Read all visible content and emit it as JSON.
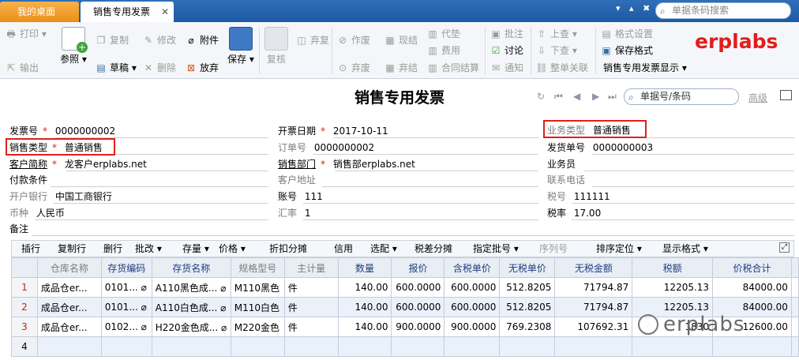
{
  "tabs": {
    "desk": "我的桌面",
    "sales": "销售专用发票",
    "close": "✕"
  },
  "global_search": {
    "placeholder": "单据条码搜索"
  },
  "logo": "erplabs",
  "toolbar": {
    "print": "打印",
    "export": "输出",
    "refer": "参照",
    "copy": "复制",
    "draft": "草稿",
    "modify": "修改",
    "delete": "删除",
    "attach": "附件",
    "discard": "放弃",
    "save": "保存",
    "review": "复核",
    "abandon": "弃复",
    "invalidate": "作废",
    "unvoid": "弃废",
    "cash": "现结",
    "uncash": "弃结",
    "advance": "代垫",
    "fee": "费用",
    "contract": "合同结算",
    "annotate": "批注",
    "discuss": "讨论",
    "notify": "通知",
    "prev": "上查",
    "next": "下查",
    "related": "整单关联",
    "format_settings": "格式设置",
    "save_format": "保存格式",
    "display_format": "销售专用发票显示"
  },
  "doc": {
    "title": "销售专用发票",
    "search_placeholder": "单据号/条码",
    "advanced": "高级"
  },
  "form": {
    "invoice_no": {
      "label": "发票号",
      "value": "0000000002"
    },
    "invoice_date": {
      "label": "开票日期",
      "value": "2017-10-11"
    },
    "biz_type": {
      "label": "业务类型",
      "value": "普通销售"
    },
    "sales_type": {
      "label": "销售类型",
      "value": "普通销售"
    },
    "order_no": {
      "label": "订单号",
      "value": "0000000002"
    },
    "ship_no": {
      "label": "发货单号",
      "value": "0000000003"
    },
    "customer": {
      "label": "客户简称",
      "value": "龙客户erplabs.net"
    },
    "dept": {
      "label": "销售部门",
      "value": "销售部erplabs.net"
    },
    "salesman": {
      "label": "业务员",
      "value": ""
    },
    "pay_terms": {
      "label": "付款条件",
      "value": ""
    },
    "cust_addr": {
      "label": "客户地址",
      "value": ""
    },
    "phone": {
      "label": "联系电话",
      "value": ""
    },
    "bank": {
      "label": "开户银行",
      "value": "中国工商银行"
    },
    "account": {
      "label": "账号",
      "value": "111"
    },
    "tax_no": {
      "label": "税号",
      "value": "111111"
    },
    "currency": {
      "label": "币种",
      "value": "人民币"
    },
    "rate": {
      "label": "汇率",
      "value": "1"
    },
    "tax_rate": {
      "label": "税率",
      "value": "17.00"
    },
    "remark": {
      "label": "备注",
      "value": ""
    }
  },
  "grid_toolbar": [
    "插行",
    "复制行",
    "删行",
    "批改",
    "存量",
    "价格",
    "折扣分摊",
    "信用",
    "选配",
    "税差分摊",
    "指定批号",
    "序列号",
    "排序定位",
    "显示格式"
  ],
  "columns": [
    "仓库名称",
    "存货编码",
    "存货名称",
    "规格型号",
    "主计量",
    "数量",
    "报价",
    "含税单价",
    "无税单价",
    "无税金额",
    "税额",
    "价税合计"
  ],
  "rows": [
    {
      "no": "1",
      "wh": "成品仓er...",
      "code": "0101...",
      "name": "A110黑色成...",
      "spec": "M110黑色",
      "unit": "件",
      "qty": "140.00",
      "quote": "600.0000",
      "tax_price": "600.0000",
      "price": "512.8205",
      "amount": "71794.87",
      "tax": "12205.13",
      "total": "84000.00"
    },
    {
      "no": "2",
      "wh": "成品仓er...",
      "code": "0101...",
      "name": "A110白色成...",
      "spec": "M110白色",
      "unit": "件",
      "qty": "140.00",
      "quote": "600.0000",
      "tax_price": "600.0000",
      "price": "512.8205",
      "amount": "71794.87",
      "tax": "12205.13",
      "total": "84000.00"
    },
    {
      "no": "3",
      "wh": "成品仓er...",
      "code": "0102...",
      "name": "H220金色成...",
      "spec": "M220金色",
      "unit": "件",
      "qty": "140.00",
      "quote": "900.0000",
      "tax_price": "900.0000",
      "price": "769.2308",
      "amount": "107692.31",
      "tax": "1830",
      "total": "12600.00"
    },
    {
      "no": "4"
    }
  ],
  "watermark": "erplabs"
}
